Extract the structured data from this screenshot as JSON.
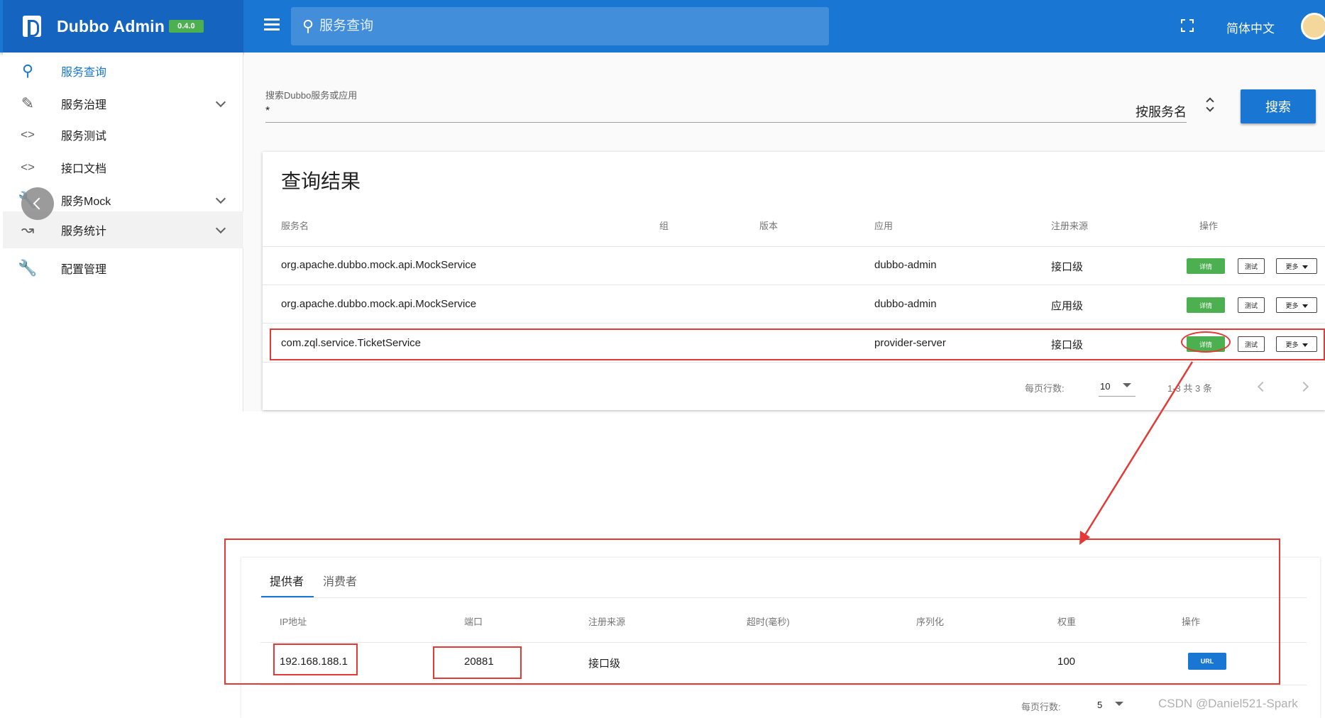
{
  "topbar": {
    "brand_name": "Dubbo Admin",
    "version": "0.4.0",
    "search_placeholder": "服务查询",
    "language": "简体中文",
    "colors": {
      "primary": "#1976d2",
      "primary_dark": "#1565c0",
      "success": "#4caf50",
      "annotation": "#e53935"
    }
  },
  "sidebar": {
    "items": [
      {
        "label": "服务查询",
        "icon": "search-icon"
      },
      {
        "label": "服务治理",
        "icon": "pencil-icon"
      },
      {
        "label": "服务测试",
        "icon": "code-icon"
      },
      {
        "label": "接口文档",
        "icon": "code-icon"
      },
      {
        "label": "服务Mock",
        "icon": "wrench-icon"
      },
      {
        "label": "服务统计",
        "icon": "trending-icon"
      },
      {
        "label": "配置管理",
        "icon": "wrench-icon"
      }
    ]
  },
  "search": {
    "label": "搜索Dubbo服务或应用",
    "value": "*",
    "mode": "按服务名",
    "button": "搜索"
  },
  "results": {
    "title": "查询结果",
    "headers": [
      "服务名",
      "组",
      "版本",
      "应用",
      "注册来源",
      "操作"
    ],
    "rows": [
      {
        "service": "org.apache.dubbo.mock.api.MockService",
        "group": "",
        "version": "",
        "app": "dubbo-admin",
        "source": "接口级"
      },
      {
        "service": "org.apache.dubbo.mock.api.MockService",
        "group": "",
        "version": "",
        "app": "dubbo-admin",
        "source": "应用级"
      },
      {
        "service": "com.zql.service.TicketService",
        "group": "",
        "version": "",
        "app": "provider-server",
        "source": "接口级"
      }
    ],
    "actions": {
      "detail": "详情",
      "test": "测试",
      "more": "更多"
    },
    "footer": {
      "rows_per_page_label": "每页行数:",
      "rows_per_page": "10",
      "range": "1-3 共 3 条"
    }
  },
  "providers": {
    "tabs": [
      "提供者",
      "消费者"
    ],
    "headers": [
      "IP地址",
      "端口",
      "注册来源",
      "超时(毫秒)",
      "序列化",
      "权重",
      "操作"
    ],
    "row": {
      "ip": "192.168.188.1",
      "port": "20881",
      "source": "接口级",
      "timeout": "",
      "serialization": "",
      "weight": "100",
      "action": "URL"
    },
    "footer": {
      "rows_per_page_label": "每页行数:",
      "rows_per_page": "5"
    }
  },
  "watermark": "CSDN @Daniel521-Spark"
}
